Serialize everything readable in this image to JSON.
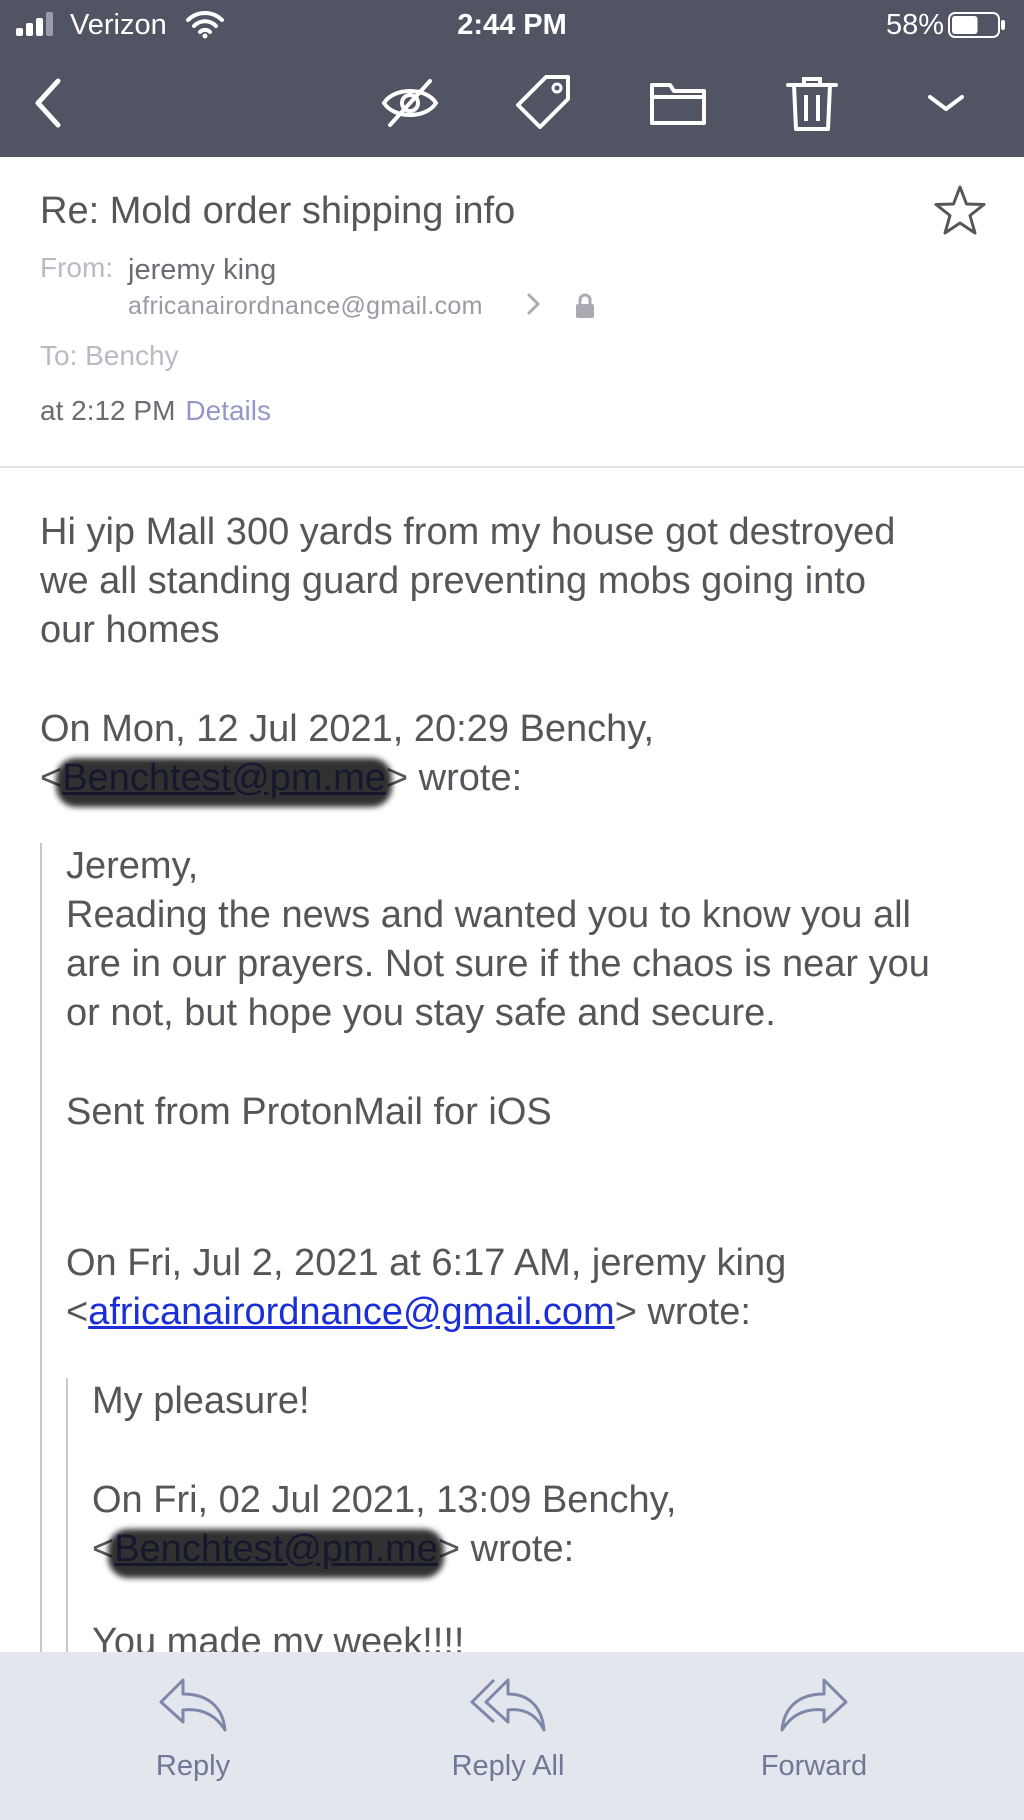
{
  "status_bar": {
    "carrier": "Verizon",
    "time": "2:44 PM",
    "battery_percent": "58%",
    "battery_level": 0.58,
    "signal_bars": 3
  },
  "toolbar": {
    "icons": [
      "back-icon",
      "mark-unread-icon",
      "label-icon",
      "folder-icon",
      "trash-icon",
      "more-icon"
    ]
  },
  "header": {
    "subject": "Re: Mold order shipping info",
    "from_label": "From:",
    "from_name": "jeremy king",
    "from_email": "africanairordnance@gmail.com",
    "to_line": "To: Benchy",
    "time": "at 2:12 PM",
    "details_label": "Details"
  },
  "message": {
    "lines": [
      "Hi yip Mall 300 yards from my house got destroyed",
      "we all standing guard preventing mobs going into",
      "our homes"
    ],
    "quote1_attribution": "On Mon, 12 Jul 2021, 20:29 Benchy,",
    "quote1_email": "Benchtest@pm.me",
    "quote1_wrote": "wrote:",
    "quote1_lines": [
      "Jeremy,",
      "Reading the news and wanted you to know you all",
      "are in our prayers. Not sure if the chaos is near you",
      "or not, but hope you stay safe and secure.",
      "Sent from ProtonMail for iOS"
    ],
    "quote2_attribution": "On Fri, Jul 2, 2021 at 6:17 AM, jeremy king",
    "quote2_email": "africanairordnance@gmail.com",
    "quote2_wrote": "wrote:",
    "quote2_lines": [
      "My pleasure!",
      "On Fri, 02 Jul 2021, 13:09 Benchy,",
      "You made my week!!!!"
    ],
    "quote3_email": "Benchtest@pm.me",
    "quote3_wrote": "wrote:"
  },
  "actions": {
    "reply": "Reply",
    "reply_all": "Reply All",
    "forward": "Forward"
  },
  "colors": {
    "toolbar_bg": "#505463",
    "link": "#1a2fd6",
    "details_link": "#9398c8",
    "action_bar_bg": "#e3e6ec",
    "action_icon": "#7d88a8"
  }
}
